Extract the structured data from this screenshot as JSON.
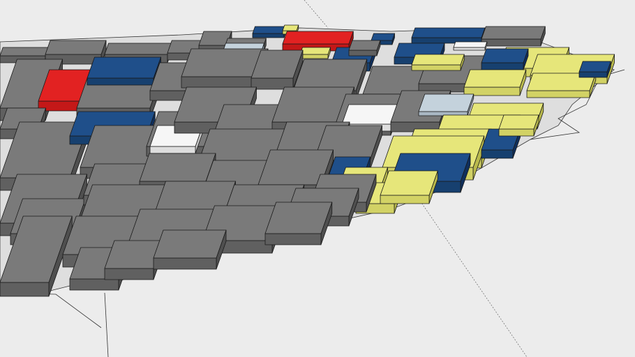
{
  "view": {
    "type": "3d-model-view",
    "background_color": "#ececec",
    "ground_color": "#dcdcdc"
  },
  "palette": {
    "gray": {
      "top": "#7a7a7a",
      "side": "#4f4f4f",
      "front": "#606060"
    },
    "yellow": {
      "top": "#e6e67a",
      "side": "#b9b94c",
      "front": "#d2d265"
    },
    "blue": {
      "top": "#1f4f8a",
      "side": "#0f2f5c",
      "front": "#17406f"
    },
    "red": {
      "top": "#e22222",
      "side": "#a10f0f",
      "front": "#c41818"
    },
    "white": {
      "top": "#f6f6f6",
      "side": "#c8c8c8",
      "front": "#dedede"
    },
    "lightblue": {
      "top": "#c4d2dc",
      "side": "#8e9ca8",
      "front": "#a9b7c3"
    }
  },
  "building_categories": [
    "gray",
    "yellow",
    "blue",
    "red",
    "white",
    "lightblue"
  ]
}
